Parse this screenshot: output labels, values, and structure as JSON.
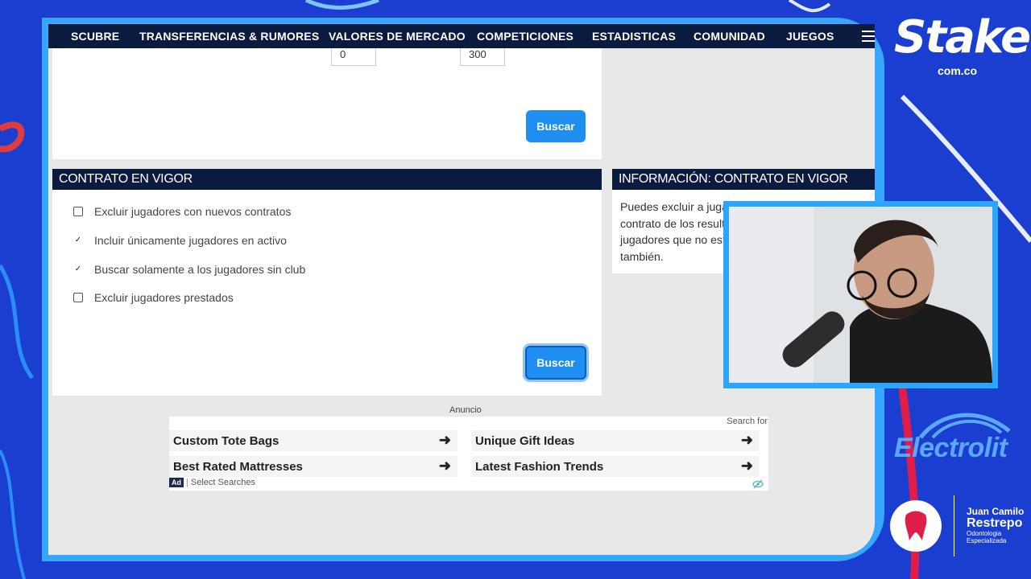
{
  "nav": {
    "items": [
      "SCUBRE",
      "TRANSFERENCIAS & RUMORES",
      "VALORES DE MERCADO",
      "COMPETICIONES",
      "ESTADISTICAS",
      "COMUNIDAD",
      "JUEGOS"
    ]
  },
  "filters": {
    "min_value": "0",
    "max_value": "300",
    "search_button": "Buscar"
  },
  "contract": {
    "title": "CONTRATO EN VIGOR",
    "options": [
      {
        "label": "Excluir jugadores con nuevos contratos",
        "checked": false
      },
      {
        "label": "Incluir únicamente jugadores en activo",
        "checked": true
      },
      {
        "label": "Buscar solamente a los jugadores sin club",
        "checked": true
      },
      {
        "label": "Excluir jugadores prestados",
        "checked": false
      }
    ],
    "search_button": "Buscar"
  },
  "info": {
    "title": "INFORMACIÓN: CONTRATO EN VIGOR",
    "lines": [
      "Puedes excluir a jugad",
      "contrato de los resulta",
      "jugadores que no está",
      "también."
    ]
  },
  "ad": {
    "label": "Anuncio",
    "search_for": "Search for",
    "items": [
      "Custom Tote Bags",
      "Unique Gift Ideas",
      "Best Rated Mattresses",
      "Latest Fashion Trends"
    ],
    "badge": "Ad",
    "footer": "Select Searches"
  },
  "overlay": {
    "stake_logo": "Stake",
    "stake_domain": "com.co",
    "electrolit_logo": "Electrolit",
    "sponsor_name_1": "Juan Camilo",
    "sponsor_name_2": "Restrepo",
    "sponsor_sub_1": "Odontologia",
    "sponsor_sub_2": "Especializada"
  },
  "colors": {
    "nav_bg": "#0b1b3f",
    "button_blue": "#1f8ef1",
    "stream_bg": "#1a3fd0",
    "frame_accent": "#36a6ff"
  }
}
